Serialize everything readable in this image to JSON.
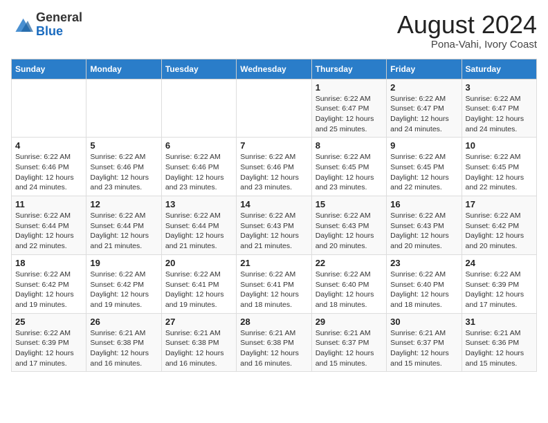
{
  "logo": {
    "general": "General",
    "blue": "Blue"
  },
  "title": "August 2024",
  "subtitle": "Pona-Vahi, Ivory Coast",
  "header": {
    "days": [
      "Sunday",
      "Monday",
      "Tuesday",
      "Wednesday",
      "Thursday",
      "Friday",
      "Saturday"
    ]
  },
  "weeks": [
    {
      "days": [
        {
          "num": "",
          "info": ""
        },
        {
          "num": "",
          "info": ""
        },
        {
          "num": "",
          "info": ""
        },
        {
          "num": "",
          "info": ""
        },
        {
          "num": "1",
          "info": "Sunrise: 6:22 AM\nSunset: 6:47 PM\nDaylight: 12 hours\nand 25 minutes."
        },
        {
          "num": "2",
          "info": "Sunrise: 6:22 AM\nSunset: 6:47 PM\nDaylight: 12 hours\nand 24 minutes."
        },
        {
          "num": "3",
          "info": "Sunrise: 6:22 AM\nSunset: 6:47 PM\nDaylight: 12 hours\nand 24 minutes."
        }
      ]
    },
    {
      "days": [
        {
          "num": "4",
          "info": "Sunrise: 6:22 AM\nSunset: 6:46 PM\nDaylight: 12 hours\nand 24 minutes."
        },
        {
          "num": "5",
          "info": "Sunrise: 6:22 AM\nSunset: 6:46 PM\nDaylight: 12 hours\nand 23 minutes."
        },
        {
          "num": "6",
          "info": "Sunrise: 6:22 AM\nSunset: 6:46 PM\nDaylight: 12 hours\nand 23 minutes."
        },
        {
          "num": "7",
          "info": "Sunrise: 6:22 AM\nSunset: 6:46 PM\nDaylight: 12 hours\nand 23 minutes."
        },
        {
          "num": "8",
          "info": "Sunrise: 6:22 AM\nSunset: 6:45 PM\nDaylight: 12 hours\nand 23 minutes."
        },
        {
          "num": "9",
          "info": "Sunrise: 6:22 AM\nSunset: 6:45 PM\nDaylight: 12 hours\nand 22 minutes."
        },
        {
          "num": "10",
          "info": "Sunrise: 6:22 AM\nSunset: 6:45 PM\nDaylight: 12 hours\nand 22 minutes."
        }
      ]
    },
    {
      "days": [
        {
          "num": "11",
          "info": "Sunrise: 6:22 AM\nSunset: 6:44 PM\nDaylight: 12 hours\nand 22 minutes."
        },
        {
          "num": "12",
          "info": "Sunrise: 6:22 AM\nSunset: 6:44 PM\nDaylight: 12 hours\nand 21 minutes."
        },
        {
          "num": "13",
          "info": "Sunrise: 6:22 AM\nSunset: 6:44 PM\nDaylight: 12 hours\nand 21 minutes."
        },
        {
          "num": "14",
          "info": "Sunrise: 6:22 AM\nSunset: 6:43 PM\nDaylight: 12 hours\nand 21 minutes."
        },
        {
          "num": "15",
          "info": "Sunrise: 6:22 AM\nSunset: 6:43 PM\nDaylight: 12 hours\nand 20 minutes."
        },
        {
          "num": "16",
          "info": "Sunrise: 6:22 AM\nSunset: 6:43 PM\nDaylight: 12 hours\nand 20 minutes."
        },
        {
          "num": "17",
          "info": "Sunrise: 6:22 AM\nSunset: 6:42 PM\nDaylight: 12 hours\nand 20 minutes."
        }
      ]
    },
    {
      "days": [
        {
          "num": "18",
          "info": "Sunrise: 6:22 AM\nSunset: 6:42 PM\nDaylight: 12 hours\nand 19 minutes."
        },
        {
          "num": "19",
          "info": "Sunrise: 6:22 AM\nSunset: 6:42 PM\nDaylight: 12 hours\nand 19 minutes."
        },
        {
          "num": "20",
          "info": "Sunrise: 6:22 AM\nSunset: 6:41 PM\nDaylight: 12 hours\nand 19 minutes."
        },
        {
          "num": "21",
          "info": "Sunrise: 6:22 AM\nSunset: 6:41 PM\nDaylight: 12 hours\nand 18 minutes."
        },
        {
          "num": "22",
          "info": "Sunrise: 6:22 AM\nSunset: 6:40 PM\nDaylight: 12 hours\nand 18 minutes."
        },
        {
          "num": "23",
          "info": "Sunrise: 6:22 AM\nSunset: 6:40 PM\nDaylight: 12 hours\nand 18 minutes."
        },
        {
          "num": "24",
          "info": "Sunrise: 6:22 AM\nSunset: 6:39 PM\nDaylight: 12 hours\nand 17 minutes."
        }
      ]
    },
    {
      "days": [
        {
          "num": "25",
          "info": "Sunrise: 6:22 AM\nSunset: 6:39 PM\nDaylight: 12 hours\nand 17 minutes."
        },
        {
          "num": "26",
          "info": "Sunrise: 6:21 AM\nSunset: 6:38 PM\nDaylight: 12 hours\nand 16 minutes."
        },
        {
          "num": "27",
          "info": "Sunrise: 6:21 AM\nSunset: 6:38 PM\nDaylight: 12 hours\nand 16 minutes."
        },
        {
          "num": "28",
          "info": "Sunrise: 6:21 AM\nSunset: 6:38 PM\nDaylight: 12 hours\nand 16 minutes."
        },
        {
          "num": "29",
          "info": "Sunrise: 6:21 AM\nSunset: 6:37 PM\nDaylight: 12 hours\nand 15 minutes."
        },
        {
          "num": "30",
          "info": "Sunrise: 6:21 AM\nSunset: 6:37 PM\nDaylight: 12 hours\nand 15 minutes."
        },
        {
          "num": "31",
          "info": "Sunrise: 6:21 AM\nSunset: 6:36 PM\nDaylight: 12 hours\nand 15 minutes."
        }
      ]
    }
  ]
}
